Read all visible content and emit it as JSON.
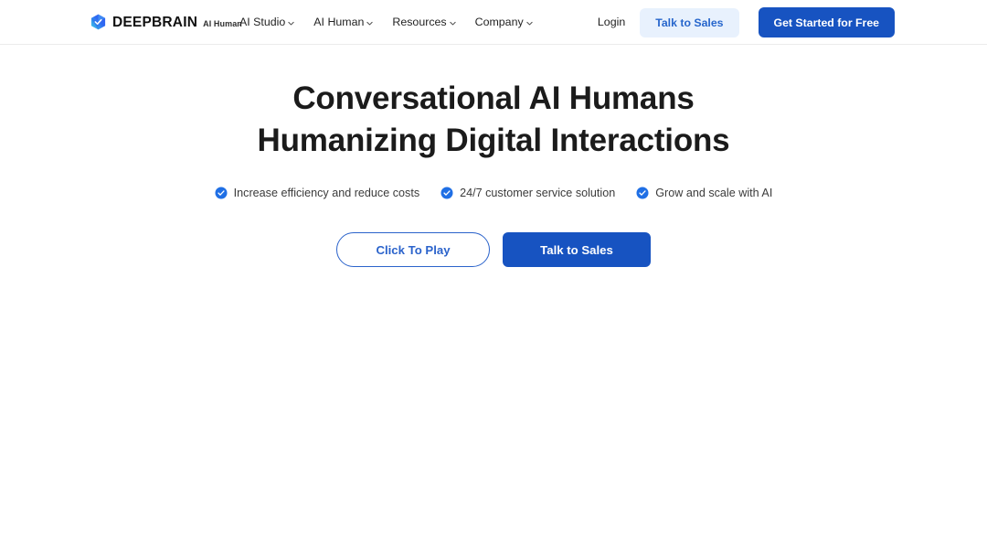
{
  "header": {
    "logo": {
      "icon": "deepbrain-cube-icon",
      "word": "DEEPBRAIN",
      "sub": "AI Human",
      "gradient_from": "#2f6bf2",
      "gradient_to": "#3fd3e8"
    },
    "nav": [
      {
        "label": "AI Studio",
        "icon": "chevron-down-icon"
      },
      {
        "label": "AI Human",
        "icon": "chevron-down-icon"
      },
      {
        "label": "Resources",
        "icon": "chevron-down-icon"
      },
      {
        "label": "Company",
        "icon": "chevron-down-icon"
      }
    ],
    "login_label": "Login",
    "talk_to_sales_label": "Talk to Sales",
    "get_started_label": "Get Started for Free",
    "colors": {
      "soft_button_bg": "#e8f1fd",
      "soft_button_text": "#2766cc",
      "primary_button_bg": "#1753c1",
      "border": "#ececec"
    }
  },
  "hero": {
    "headline_line1": "Conversational AI Humans",
    "headline_line2": "Humanizing Digital Interactions",
    "features": [
      {
        "icon": "check-circle-icon",
        "label": "Increase efficiency and reduce costs"
      },
      {
        "icon": "check-circle-icon",
        "label": "24/7 customer service solution"
      },
      {
        "icon": "check-circle-icon",
        "label": "Grow and scale with AI"
      }
    ],
    "cta": {
      "play_label": "Click To Play",
      "sales_label": "Talk to Sales"
    },
    "colors": {
      "headline": "#1b1b1b",
      "feature_text": "#3b3b3b",
      "accent": "#2b63cb",
      "check_badge": "#1f6fe5"
    }
  }
}
